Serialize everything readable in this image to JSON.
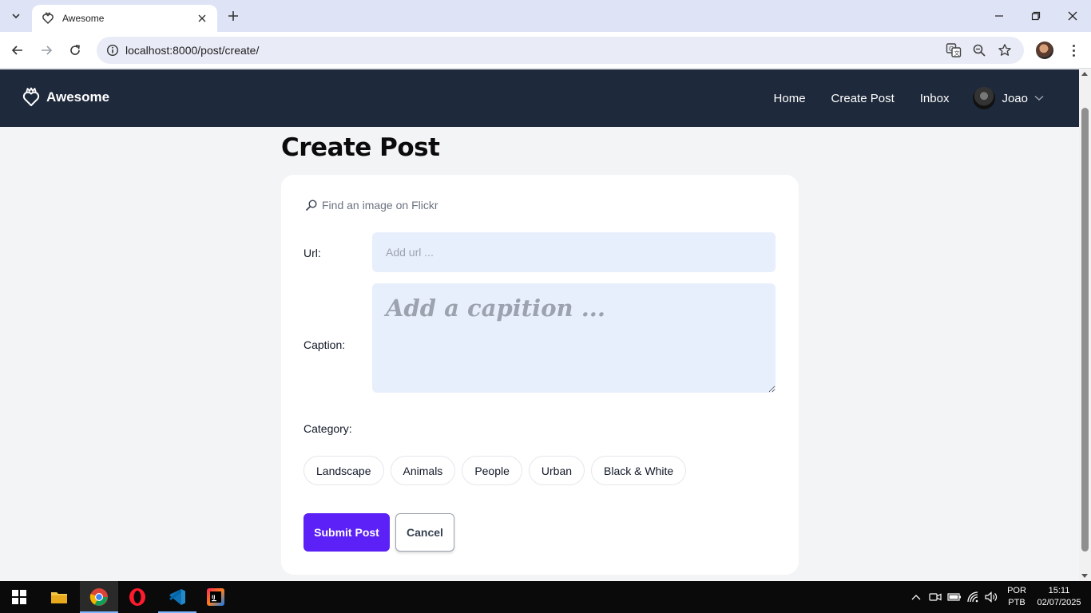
{
  "browser": {
    "tab_title": "Awesome",
    "url": "localhost:8000/post/create/"
  },
  "site": {
    "brand": "Awesome",
    "nav": {
      "home": "Home",
      "create_post": "Create Post",
      "inbox": "Inbox"
    },
    "user_name": "Joao"
  },
  "page": {
    "title": "Create Post",
    "flickr_search": "Find an image on Flickr",
    "url_label": "Url:",
    "url_placeholder": "Add url ...",
    "caption_label": "Caption:",
    "caption_placeholder": "Add a capition ...",
    "category_label": "Category:",
    "categories": [
      "Landscape",
      "Animals",
      "People",
      "Urban",
      "Black & White"
    ],
    "submit_label": "Submit Post",
    "cancel_label": "Cancel"
  },
  "colors": {
    "header_bg": "#1e293b",
    "accent": "#5b21f6",
    "input_bg": "#e8effc"
  },
  "taskbar": {
    "lang_1": "POR",
    "lang_2": "PTB",
    "time": "15:11",
    "date": "02/07/2025"
  }
}
